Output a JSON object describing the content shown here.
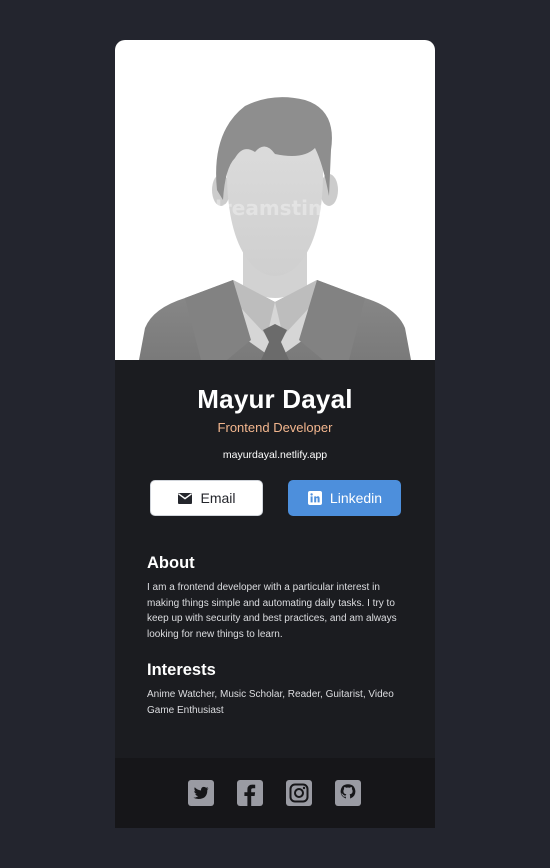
{
  "profile": {
    "name": "Mayur Dayal",
    "role": "Frontend Developer",
    "website": "mayurdayal.netlify.app",
    "photo_watermark": "dreamstime"
  },
  "buttons": {
    "email_label": "Email",
    "linkedin_label": "Linkedin"
  },
  "about": {
    "title": "About",
    "text": "I am a frontend developer with a particular interest in making things simple and automating daily tasks. I try to keep up with security and best practices, and am always looking for new things to learn."
  },
  "interests": {
    "title": "Interests",
    "text": "Anime Watcher, Music Scholar, Reader, Guitarist, Video Game Enthusiast"
  },
  "footer": {
    "icons": [
      "twitter-icon",
      "facebook-icon",
      "instagram-icon",
      "github-icon"
    ]
  },
  "colors": {
    "background": "#23252e",
    "card": "#1b1c20",
    "footer": "#161619",
    "role_accent": "#f3b68e",
    "linkedin_button": "#4d8fdc",
    "social_icon": "#9a9ba3"
  }
}
